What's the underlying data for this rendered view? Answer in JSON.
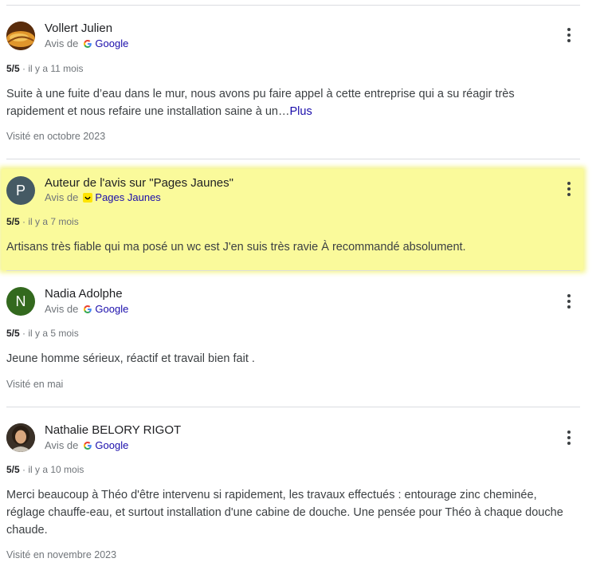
{
  "reviews": [
    {
      "author": "Vollert Julien",
      "avis_de": "Avis de",
      "source": "Google",
      "rating": "5/5",
      "time": "il y a 11 mois",
      "text": "Suite à une fuite d’eau dans le mur, nous avons pu faire appel à cette entreprise qui a su réagir très rapidement et nous refaire une installation saine à un…",
      "more": "Plus",
      "visited": "Visité en octobre 2023"
    },
    {
      "author": "Auteur de l'avis sur \"Pages Jaunes\"",
      "avatar_letter": "P",
      "avis_de": "Avis de",
      "source": "Pages Jaunes",
      "rating": "5/5",
      "time": "il y a 7 mois",
      "text": "Artisans très fiable qui ma posé un wc est J'en suis très ravie À recommandé absolument."
    },
    {
      "author": "Nadia Adolphe",
      "avatar_letter": "N",
      "avis_de": "Avis de",
      "source": "Google",
      "rating": "5/5",
      "time": "il y a 5 mois",
      "text": "Jeune homme sérieux, réactif et travail bien fait .",
      "visited": "Visité en mai"
    },
    {
      "author": "Nathalie BELORY RIGOT",
      "avis_de": "Avis de",
      "source": "Google",
      "rating": "5/5",
      "time": "il y a 10 mois",
      "text": "Merci beaucoup à Théo d'être intervenu si rapidement, les travaux effectués : entourage zinc cheminée, réglage chauffe-eau, et surtout installation d'une cabine de douche. Une pensée pour Théo à chaque douche chaude.",
      "visited": "Visité en novembre 2023"
    }
  ],
  "colors": {
    "highlight": "#fafa9b",
    "avatar_p": "#455a64",
    "avatar_n": "#33691e",
    "link": "#1a0dab"
  },
  "icons": {
    "google": "google-g-icon",
    "pagesjaunes": "pages-jaunes-smiley-icon",
    "menu": "more-vert-icon"
  }
}
